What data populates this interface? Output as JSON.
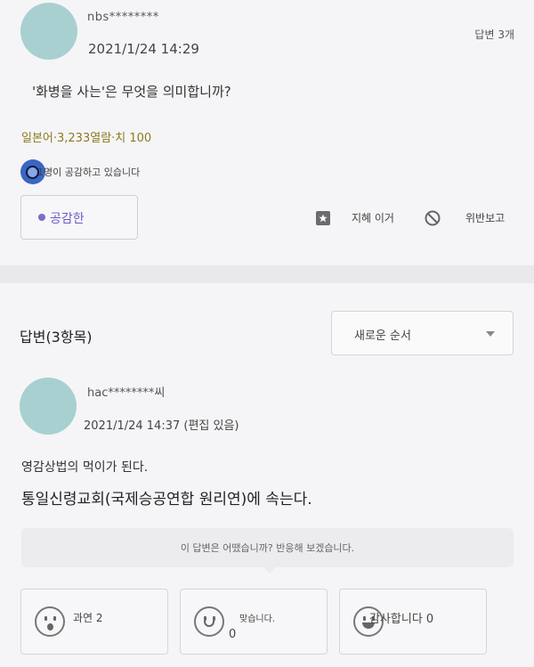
{
  "question": {
    "author": "nbs********",
    "date": "2021/1/24 14:29",
    "answer_count": "답변 3개",
    "body": "'화병을 사는'은 무엇을 의미합니까?",
    "meta": "일본어·3,233열람·치 100",
    "empathy_text": "1명이 공감하고 있습니다",
    "empathy_button": "공감한",
    "bookmark_label": "지혜 이거",
    "report_label": "위반보고"
  },
  "answers_section": {
    "title": "답변(3항목)",
    "sort": "새로운 순서"
  },
  "answer": {
    "author": "hac********씨",
    "date": "2021/1/24 14:37 (편집 있음)",
    "line1": "영감상법의 먹이가 된다.",
    "line2": "통일신령교회(국제승공연합 원리연)에 속는다.",
    "feedback_prompt": "이 답변은 어땠습니까? 반응해 보겠습니다.",
    "reactions": [
      {
        "label": "과연 2",
        "icon": "surprised-face-icon"
      },
      {
        "label": "맞습니다.",
        "count": "0",
        "icon": "smile-face-icon"
      },
      {
        "label": "감사합니다 0",
        "icon": "grin-face-icon"
      }
    ]
  },
  "colors": {
    "accent": "#6a5cc1",
    "meta": "#8c7a1f",
    "avatar": "#a9d0d1",
    "badge": "#3a66c4"
  }
}
